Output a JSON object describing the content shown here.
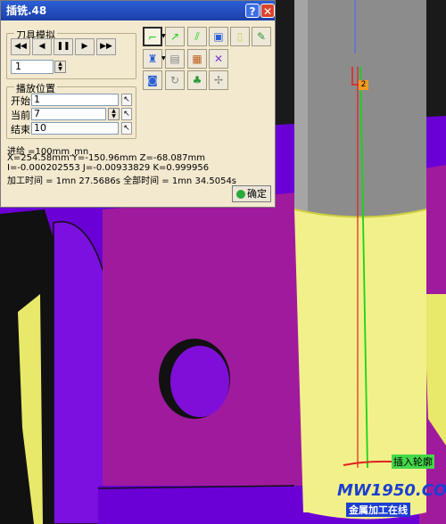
{
  "dialog": {
    "title": "插铣.48",
    "help_button": "?",
    "close_button": "✕",
    "tool_sim_group": "刀具模拟",
    "playback_buttons": [
      "◀◀",
      "◀",
      "❚❚",
      "▶",
      "▶▶"
    ],
    "step_value": "1",
    "position_group": "播放位置",
    "start_label": "开始",
    "start_value": "1",
    "current_label": "当前",
    "current_value": "7",
    "end_label": "结束",
    "end_value": "10",
    "feed": "进给 =100mm_mn",
    "xyz": "X=254.58mm Y=-150.96mm Z=-68.087mm",
    "ijk": "I=-0.000202553 J=-0.00933829 K=0.999956",
    "time": "加工时间 = 1mn 27.5686s   全部时间 = 1mn 34.5054s",
    "ok_button": "确定",
    "toolbar_icons": [
      "path-icon",
      "arrow-path-icon",
      "cut-icon",
      "photo-icon",
      "tube-icon",
      "palette-icon",
      "tool-icon",
      "save-icon",
      "clipboard-icon",
      "compare-icon",
      "camera-icon",
      "rotate-icon",
      "tree-icon",
      "fan-icon"
    ]
  },
  "scene": {
    "point_tag": "2",
    "plunge_label": "插入轮廓"
  },
  "watermark": {
    "site": "MW1950.COM",
    "subtitle": "金属加工在线"
  },
  "colors": {
    "part_purple": "#6b00d6",
    "face_magenta": "#a01a9e",
    "tool_gray": "#8c8c8c",
    "tool_yellow": "#f2f08a",
    "path_green": "#1bd21b",
    "path_red": "#e02020",
    "title_blue": "#2b5fd6"
  }
}
